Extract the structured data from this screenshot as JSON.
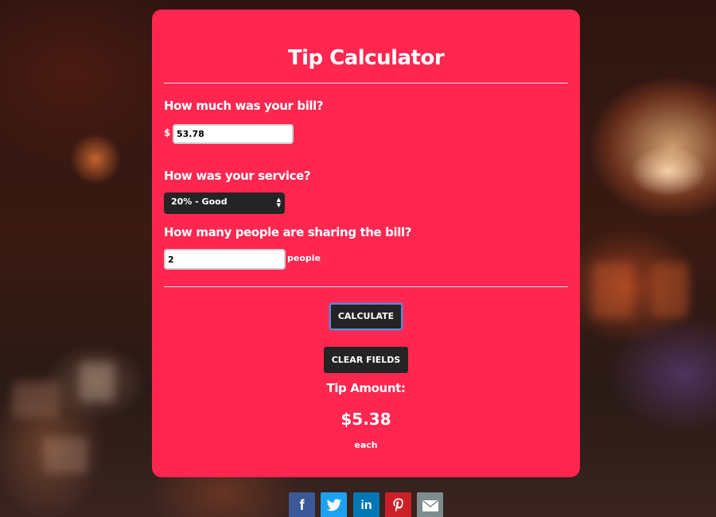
{
  "calculator": {
    "title": "Tip Calculator",
    "bill_question": "How much was your bill?",
    "currency_symbol": "$",
    "bill_value": "53.78",
    "service_question": "How was your service?",
    "service_selected": "20% - Good",
    "people_question": "How many people are sharing the bill?",
    "people_value": "2",
    "people_suffix": "people",
    "calculate_label": "CALCULATE",
    "clear_label": "CLEAR FIELDS",
    "tip_label": "Tip Amount:",
    "tip_amount": "$5.38",
    "each_label": "each"
  },
  "share": {
    "facebook_glyph": "f",
    "twitter_glyph": "twitter-bird",
    "linkedin_glyph": "in",
    "pinterest_glyph": "P",
    "email_glyph": "envelope"
  },
  "colors": {
    "card": "#ff2650",
    "button": "#242424",
    "facebook": "#3b5998",
    "twitter": "#1da1f2",
    "linkedin": "#0077b5",
    "pinterest": "#cb2027",
    "email": "#7f8c8d"
  }
}
